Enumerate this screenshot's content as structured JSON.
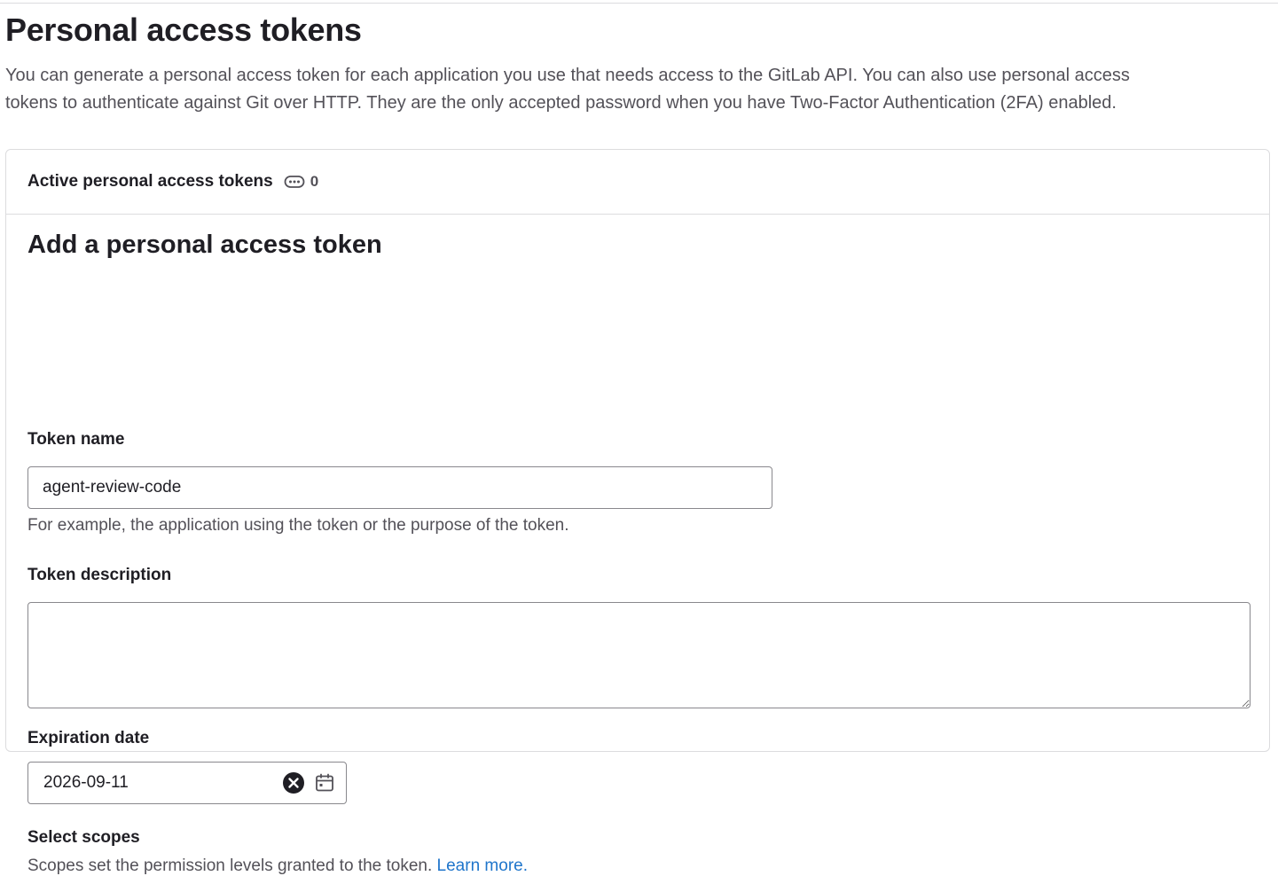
{
  "page": {
    "title": "Personal access tokens",
    "intro_line1": "You can generate a personal access token for each application you use that needs access to the GitLab API. You can also use personal access",
    "intro_line2": "tokens to authenticate against Git over HTTP. They are the only accepted password when you have Two-Factor Authentication (2FA) enabled."
  },
  "active_tokens": {
    "label": "Active personal access tokens",
    "count": "0",
    "icon": "token-icon"
  },
  "form": {
    "heading": "Add a personal access token",
    "token_name": {
      "label": "Token name",
      "value": "agent-review-code",
      "help": "For example, the application using the token or the purpose of the token."
    },
    "token_description": {
      "label": "Token description",
      "value": ""
    },
    "expiration": {
      "label": "Expiration date",
      "value": "2026-09-11",
      "clear_icon": "clear-icon",
      "calendar_icon": "calendar-icon"
    },
    "scopes": {
      "label": "Select scopes",
      "help": "Scopes set the permission levels granted to the token.",
      "learn_more": "Learn more."
    }
  },
  "colors": {
    "text": "#1f1e24",
    "muted": "#535158",
    "border": "#dcdcde",
    "input_border": "#89888d",
    "link": "#1f75cb"
  }
}
